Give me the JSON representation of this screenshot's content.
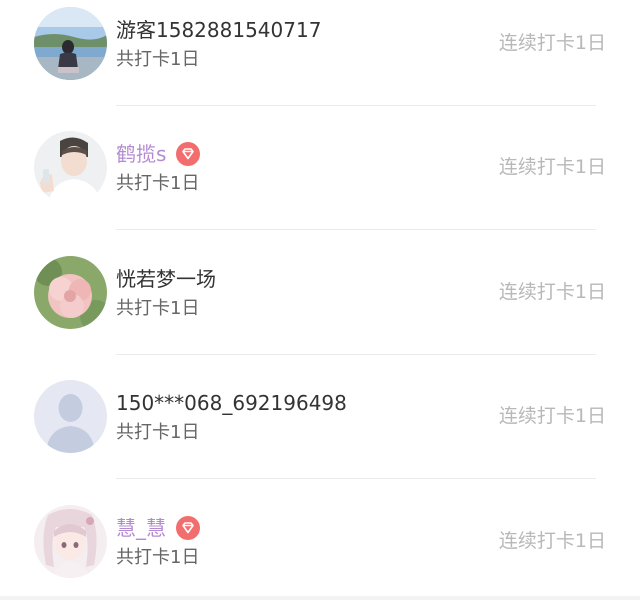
{
  "checkin_list": [
    {
      "name": "游客1582881540717",
      "is_vip": false,
      "avatar": "photo-avatar-lakeside",
      "total_label": "共打卡1日",
      "streak_label": "连续打卡1日"
    },
    {
      "name": "鹤揽s",
      "is_vip": true,
      "avatar": "photo-avatar-man",
      "total_label": "共打卡1日",
      "streak_label": "连续打卡1日"
    },
    {
      "name": "恍若梦一场",
      "is_vip": false,
      "avatar": "photo-avatar-flower",
      "total_label": "共打卡1日",
      "streak_label": "连续打卡1日"
    },
    {
      "name": "150***068_692196498",
      "is_vip": false,
      "avatar": "default-avatar-silhouette",
      "total_label": "共打卡1日",
      "streak_label": "连续打卡1日"
    },
    {
      "name": "慧_慧",
      "is_vip": true,
      "avatar": "photo-avatar-anime-girl",
      "total_label": "共打卡1日",
      "streak_label": "连续打卡1日"
    }
  ],
  "colors": {
    "vip_name": "#b48bd2",
    "vip_badge": "#f26d6d",
    "streak_text": "#b8b8b8",
    "divider": "#ececec"
  },
  "icons": {
    "vip_badge": "diamond-badge-icon"
  }
}
